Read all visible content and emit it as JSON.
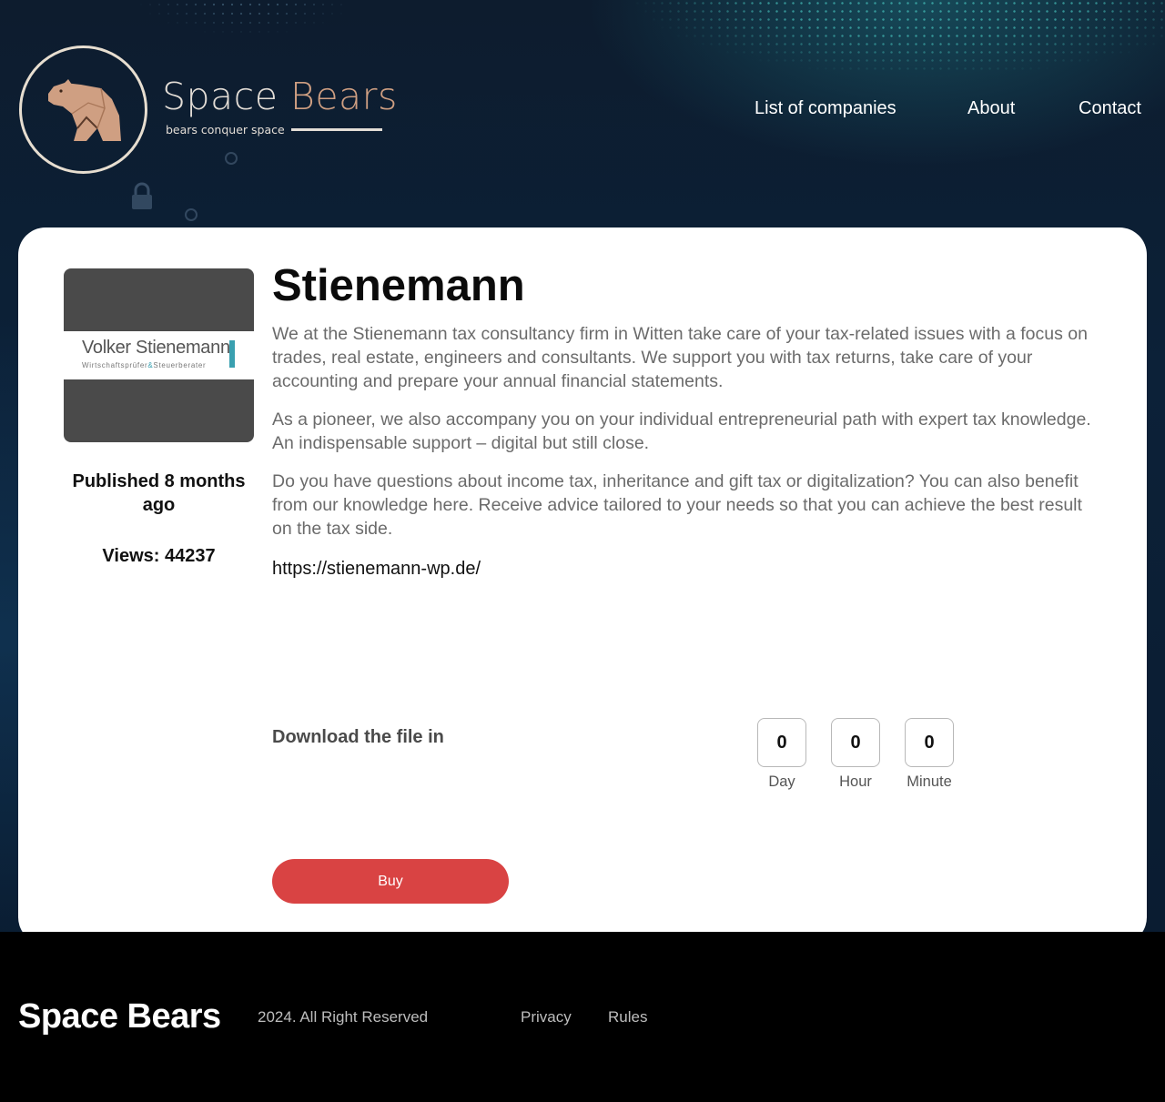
{
  "brand": {
    "name_part1": "Space ",
    "name_part2": "Bears",
    "tagline": "bears conquer space"
  },
  "nav": {
    "items": [
      {
        "label": "List of companies"
      },
      {
        "label": "About"
      },
      {
        "label": "Contact"
      }
    ]
  },
  "company": {
    "logo_name": "Volker Stienemann",
    "logo_subtitle_left": "Wirtschaftsprüfer",
    "logo_subtitle_amp": "&",
    "logo_subtitle_right": "Steuerberater",
    "name": "Stienemann",
    "published": "Published 8 months ago",
    "views": "Views: 44237",
    "description": [
      "We at the Stienemann tax consultancy firm in Witten take care of your tax-related issues with a focus on trades, real estate, engineers and consultants. We support you with tax returns, take care of your accounting and prepare your annual financial statements.",
      "As a pioneer, we also accompany you on your individual entrepreneurial path with expert tax knowledge. An indispensable support – digital but still close.",
      "Do you have questions about income tax, inheritance and gift tax or digitalization? You can also benefit from our knowledge here. Receive advice tailored to your needs so that you can achieve the best result on the tax side."
    ],
    "website": "https://stienemann-wp.de/"
  },
  "download": {
    "label": "Download the file in",
    "countdown": [
      {
        "value": "0",
        "unit": "Day"
      },
      {
        "value": "0",
        "unit": "Hour"
      },
      {
        "value": "0",
        "unit": "Minute"
      }
    ]
  },
  "buy_label": "Buy",
  "footer": {
    "brand": "Space Bears",
    "copyright": "2024. All Right Reserved",
    "links": [
      {
        "label": "Privacy"
      },
      {
        "label": "Rules"
      }
    ]
  },
  "colors": {
    "accent_copper": "#cf9f82",
    "buy_red": "#d94343",
    "logo_teal": "#3aa0b0"
  }
}
